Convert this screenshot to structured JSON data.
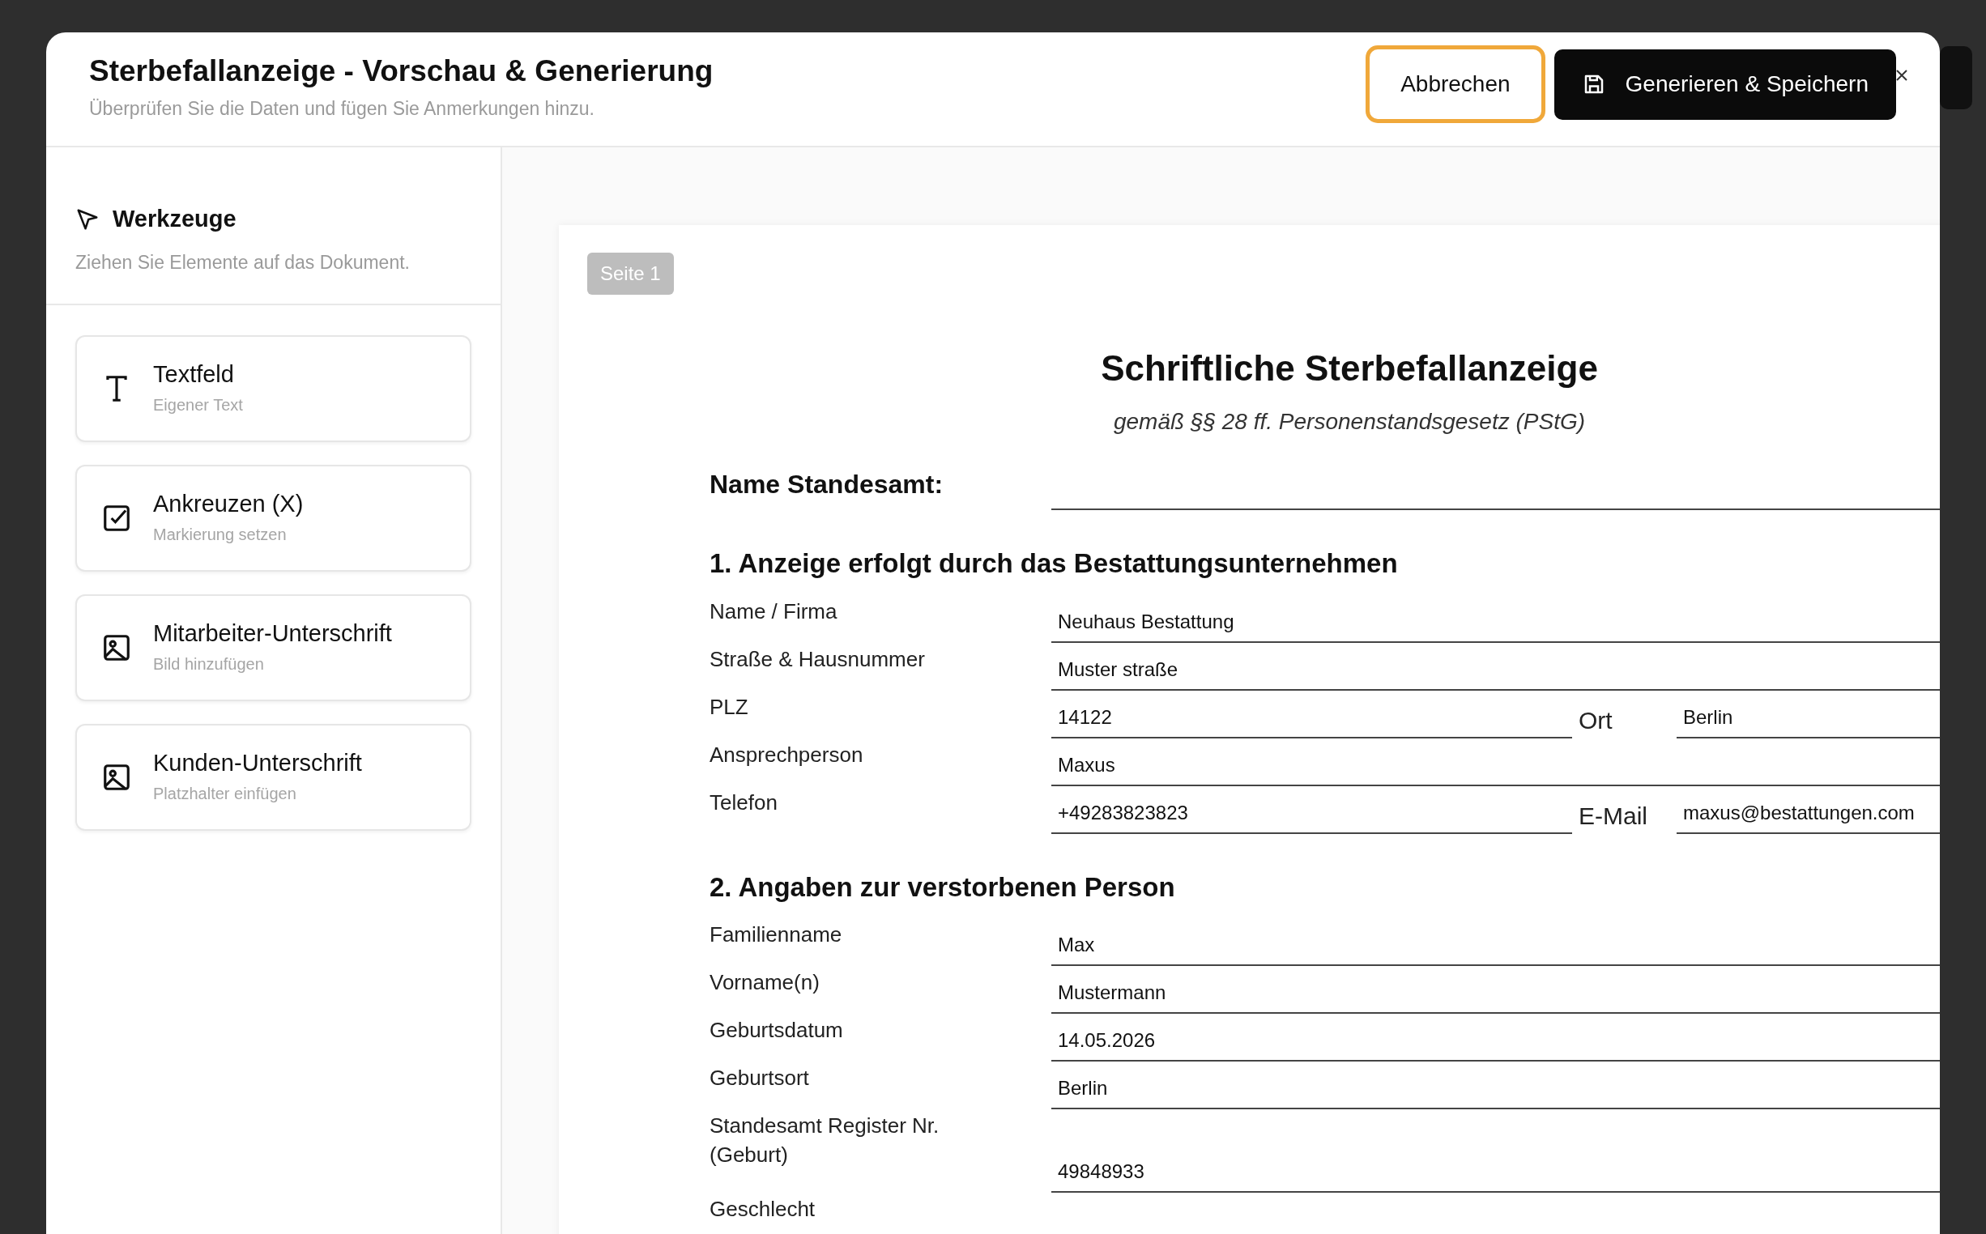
{
  "dialog": {
    "title": "Sterbefallanzeige - Vorschau & Generierung",
    "subtitle": "Überprüfen Sie die Daten und fügen Sie Anmerkungen hinzu.",
    "buttons": [
      {
        "label": "Abbrechen",
        "kind": "secondary",
        "focused": true
      },
      {
        "label": "Generieren & Speichern",
        "kind": "primary",
        "focused": false
      }
    ]
  },
  "tools": {
    "title": "Werkzeuge",
    "subtitle": "Ziehen Sie Elemente auf das Dokument.",
    "items": [
      {
        "kind": "text",
        "title": "Textfeld",
        "subtitle": "Eigener Text"
      },
      {
        "kind": "checkbox",
        "title": "Ankreuzen (X)",
        "subtitle": "Markierung setzen"
      },
      {
        "kind": "image",
        "title": "Mitarbeiter-Unterschrift",
        "subtitle": "Bild hinzufügen"
      },
      {
        "kind": "image",
        "title": "Kunden-Unterschrift",
        "subtitle": "Platzhalter einfügen"
      }
    ]
  },
  "document": {
    "page_label": "Seite 1",
    "title": "Schriftliche Sterbefallanzeige",
    "subtitle": "gemäß §§ 28 ff. Personenstandsgesetz (PStG)",
    "registry_label": "Name Standesamt:",
    "sections": [
      {
        "heading": "1. Anzeige erfolgt durch das Bestattungsunternehmen",
        "fields": [
          {
            "label": "Name / Firma",
            "value": "Neuhaus Bestattung"
          },
          {
            "label": "Straße & Hausnummer",
            "value": "Muster straße"
          },
          {
            "label": "PLZ",
            "value": "14122",
            "side_label": "Ort",
            "side_value": "Berlin"
          },
          {
            "label": "Ansprechperson",
            "value": "Maxus"
          },
          {
            "label": "Telefon",
            "value": "+49283823823",
            "side_label": "E-Mail",
            "side_value": "maxus@bestattungen.com"
          }
        ]
      },
      {
        "heading": "2. Angaben zur verstorbenen Person",
        "fields": [
          {
            "label": "Familienname",
            "value": "Max"
          },
          {
            "label": "Vorname(n)",
            "value": "Mustermann"
          },
          {
            "label": "Geburtsdatum",
            "value": "14.05.2026"
          },
          {
            "label": "Geburtsort",
            "value": "Berlin"
          },
          {
            "label": "Standesamt Register Nr. (Geburt)",
            "value": "49848933"
          },
          {
            "label": "Geschlecht"
          }
        ]
      }
    ]
  }
}
